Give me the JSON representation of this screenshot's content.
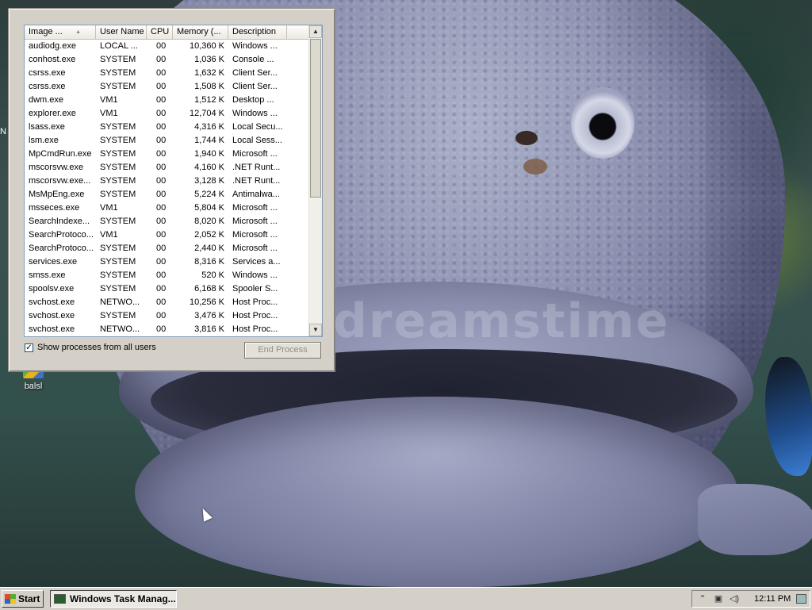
{
  "desktop": {
    "watermark": "dreamstime",
    "icon_label": "balsl",
    "edge_label": "N"
  },
  "task_manager": {
    "columns": [
      "Image ...",
      "User Name",
      "CPU",
      "Memory (...",
      "Description"
    ],
    "processes": [
      {
        "image": "audiodg.exe",
        "user": "LOCAL ...",
        "cpu": "00",
        "memory": "10,360 K",
        "description": "Windows ..."
      },
      {
        "image": "conhost.exe",
        "user": "SYSTEM",
        "cpu": "00",
        "memory": "1,036 K",
        "description": "Console ..."
      },
      {
        "image": "csrss.exe",
        "user": "SYSTEM",
        "cpu": "00",
        "memory": "1,632 K",
        "description": "Client Ser..."
      },
      {
        "image": "csrss.exe",
        "user": "SYSTEM",
        "cpu": "00",
        "memory": "1,508 K",
        "description": "Client Ser..."
      },
      {
        "image": "dwm.exe",
        "user": "VM1",
        "cpu": "00",
        "memory": "1,512 K",
        "description": "Desktop ..."
      },
      {
        "image": "explorer.exe",
        "user": "VM1",
        "cpu": "00",
        "memory": "12,704 K",
        "description": "Windows ..."
      },
      {
        "image": "lsass.exe",
        "user": "SYSTEM",
        "cpu": "00",
        "memory": "4,316 K",
        "description": "Local Secu..."
      },
      {
        "image": "lsm.exe",
        "user": "SYSTEM",
        "cpu": "00",
        "memory": "1,744 K",
        "description": "Local Sess..."
      },
      {
        "image": "MpCmdRun.exe",
        "user": "SYSTEM",
        "cpu": "00",
        "memory": "1,940 K",
        "description": "Microsoft ..."
      },
      {
        "image": "mscorsvw.exe",
        "user": "SYSTEM",
        "cpu": "00",
        "memory": "4,160 K",
        "description": ".NET Runt..."
      },
      {
        "image": "mscorsvw.exe...",
        "user": "SYSTEM",
        "cpu": "00",
        "memory": "3,128 K",
        "description": ".NET Runt..."
      },
      {
        "image": "MsMpEng.exe",
        "user": "SYSTEM",
        "cpu": "00",
        "memory": "5,224 K",
        "description": "Antimalwa..."
      },
      {
        "image": "msseces.exe",
        "user": "VM1",
        "cpu": "00",
        "memory": "5,804 K",
        "description": "Microsoft ..."
      },
      {
        "image": "SearchIndexe...",
        "user": "SYSTEM",
        "cpu": "00",
        "memory": "8,020 K",
        "description": "Microsoft ..."
      },
      {
        "image": "SearchProtoco...",
        "user": "VM1",
        "cpu": "00",
        "memory": "2,052 K",
        "description": "Microsoft ..."
      },
      {
        "image": "SearchProtoco...",
        "user": "SYSTEM",
        "cpu": "00",
        "memory": "2,440 K",
        "description": "Microsoft ..."
      },
      {
        "image": "services.exe",
        "user": "SYSTEM",
        "cpu": "00",
        "memory": "8,316 K",
        "description": "Services a..."
      },
      {
        "image": "smss.exe",
        "user": "SYSTEM",
        "cpu": "00",
        "memory": "520 K",
        "description": "Windows ..."
      },
      {
        "image": "spoolsv.exe",
        "user": "SYSTEM",
        "cpu": "00",
        "memory": "6,168 K",
        "description": "Spooler S..."
      },
      {
        "image": "svchost.exe",
        "user": "NETWO...",
        "cpu": "00",
        "memory": "10,256 K",
        "description": "Host Proc..."
      },
      {
        "image": "svchost.exe",
        "user": "SYSTEM",
        "cpu": "00",
        "memory": "3,476 K",
        "description": "Host Proc..."
      },
      {
        "image": "svchost.exe",
        "user": "NETWO...",
        "cpu": "00",
        "memory": "3,816 K",
        "description": "Host Proc..."
      }
    ],
    "show_all_label": "Show processes from all users",
    "show_all_checked": true,
    "end_process_label": "End Process"
  },
  "taskbar": {
    "start_label": "Start",
    "task_button_label": "Windows Task Manag...",
    "clock": "12:11 PM",
    "tray_icons": [
      "chevron-up-icon",
      "network-icon",
      "volume-icon"
    ]
  }
}
